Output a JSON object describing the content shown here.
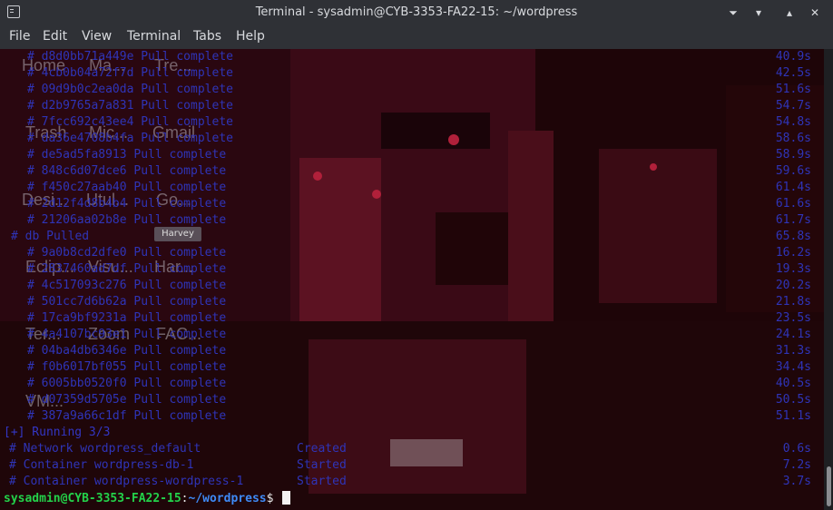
{
  "window": {
    "title": "Terminal - sysadmin@CYB-3353-FA22-15: ~/wordpress",
    "app_icon": "terminal-icon",
    "controls": [
      "minimize-icon",
      "restore-icon",
      "maximize-icon",
      "close-icon"
    ]
  },
  "menu": [
    "File",
    "Edit",
    "View",
    "Terminal",
    "Tabs",
    "Help"
  ],
  "desktop": {
    "labels": [
      "Home",
      "Ma...",
      "Tre...",
      "Trash",
      "Mic...",
      "Gmail",
      "Desi...",
      "Utul...",
      "Go...",
      "Eclip...",
      "Visu...",
      "Har...",
      "Ter...",
      "Zoom",
      "FAC...",
      "VM..."
    ],
    "harvey_badge": "Harvey"
  },
  "pull_lines": [
    {
      "id": "d8d0bb71a449e",
      "status": "Pull complete",
      "time": "40.9s"
    },
    {
      "id": "4cb0b04a72f7d",
      "status": "Pull complete",
      "time": "42.5s"
    },
    {
      "id": "09d9b0c2ea0da",
      "status": "Pull complete",
      "time": "51.6s"
    },
    {
      "id": "d2b9765a7a831",
      "status": "Pull complete",
      "time": "54.7s"
    },
    {
      "id": "7fcc692c43ee4",
      "status": "Pull complete",
      "time": "54.8s"
    },
    {
      "id": "da36e4708b4fa",
      "status": "Pull complete",
      "time": "58.6s"
    },
    {
      "id": "de5ad5fa8913",
      "status": "Pull complete",
      "time": "58.9s"
    },
    {
      "id": "848c6d07dce6",
      "status": "Pull complete",
      "time": "59.6s"
    },
    {
      "id": "f450c27aab40",
      "status": "Pull complete",
      "time": "61.4s"
    },
    {
      "id": "2d12f4d8b4b4",
      "status": "Pull complete",
      "time": "61.6s"
    },
    {
      "id": "21206aa02b8e",
      "status": "Pull complete",
      "time": "61.7s"
    }
  ],
  "pulled_line": {
    "text": "# db Pulled",
    "time": "65.8s"
  },
  "pull_lines_2": [
    {
      "id": "9a0b8cd2dfe0",
      "status": "Pull complete",
      "time": "16.2s"
    },
    {
      "id": "2837460ad7df",
      "status": "Pull complete",
      "time": "19.3s"
    },
    {
      "id": "4c517093c276",
      "status": "Pull complete",
      "time": "20.2s"
    },
    {
      "id": "501cc7d6b62a",
      "status": "Pull complete",
      "time": "21.8s"
    },
    {
      "id": "17ca9bf9231a",
      "status": "Pull complete",
      "time": "23.5s"
    },
    {
      "id": "4a4107bc93e1",
      "status": "Pull complete",
      "time": "24.1s"
    },
    {
      "id": "04ba4db6346e",
      "status": "Pull complete",
      "time": "31.3s"
    },
    {
      "id": "f0b6017bf055",
      "status": "Pull complete",
      "time": "34.4s"
    },
    {
      "id": "6005bb0520f0",
      "status": "Pull complete",
      "time": "40.5s"
    },
    {
      "id": "d07359d5705e",
      "status": "Pull complete",
      "time": "50.5s"
    },
    {
      "id": "387a9a66c1df",
      "status": "Pull complete",
      "time": "51.1s"
    }
  ],
  "running": "[+] Running 3/3",
  "containers": [
    {
      "name": "# Network wordpress_default",
      "status": "Created",
      "time": "0.6s"
    },
    {
      "name": "# Container wordpress-db-1",
      "status": "Started",
      "time": "7.2s"
    },
    {
      "name": "# Container wordpress-wordpress-1",
      "status": "Started",
      "time": "3.7s"
    }
  ],
  "prompt": {
    "user_host": "sysadmin@CYB-3353-FA22-15",
    "sep": ":",
    "path": "~/wordpress",
    "dollar": "$ "
  },
  "colors": {
    "blue_text": "#2f34b8",
    "prompt_green": "#23d24a",
    "prompt_blue": "#3e8af6",
    "chrome": "#2f3136"
  }
}
